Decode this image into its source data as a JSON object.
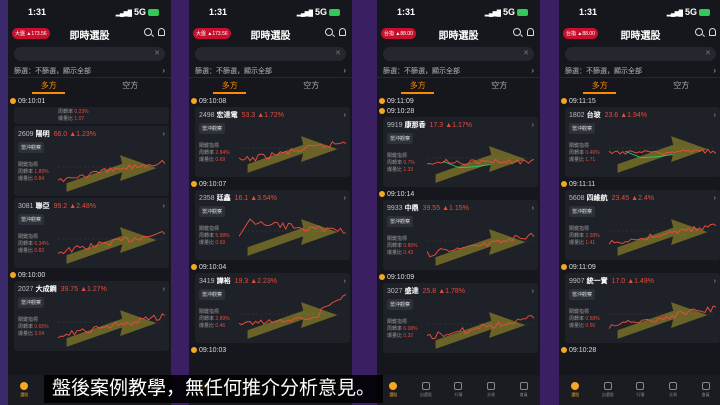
{
  "caption": "盤後案例教學，無任何推介分析意見。",
  "common": {
    "title": "即時選股",
    "filter_text": "篩選：不篩選，顯示全部",
    "tab_long": "多方",
    "tab_short": "空方",
    "observe_label": "當沖觀察",
    "index_label": "關鍵指標",
    "turnover_label": "周轉率",
    "volume_ratio_label": "爆量比",
    "close_mark": "✕",
    "chevron": "›",
    "bottom_nav": [
      "選股",
      "自選股",
      "行情",
      "交易",
      "會員"
    ]
  },
  "colors": {
    "accent": "#ff8a00",
    "up": "#e74c3c",
    "down": "#2ecc71",
    "background": "#15171c"
  },
  "phones": [
    {
      "status_time": "1:31",
      "network": "5G",
      "badge": "大盤 ▲173.56",
      "entries": [
        {
          "time": "09:10:01",
          "card": null,
          "turnover": "0.23%",
          "volume": "1.07",
          "partial": true
        },
        {
          "time": null,
          "card": {
            "code": "2609",
            "name": "陽明",
            "price": "66.0",
            "chg": "▲1.23%"
          },
          "turnover": "1.89%",
          "volume": "0.84"
        },
        {
          "time": null,
          "card": {
            "code": "3081",
            "name": "聯亞",
            "price": "99.2",
            "chg": "▲2.48%"
          },
          "turnover": "6.34%",
          "volume": "0.82"
        },
        {
          "time": "09:10:00",
          "card": {
            "code": "2027",
            "name": "大成鋼",
            "price": "39.75",
            "chg": "▲1.27%"
          },
          "turnover": "0.65%",
          "volume": "3.04"
        }
      ]
    },
    {
      "status_time": "1:31",
      "network": "5G",
      "badge": "大盤 ▲173.56",
      "entries": [
        {
          "time": "09:10:08",
          "card": {
            "code": "2498",
            "name": "宏達電",
            "price": "53.3",
            "chg": "▲1.72%"
          },
          "turnover": "2.84%",
          "volume": "0.69"
        },
        {
          "time": "09:10:07",
          "card": {
            "code": "2358",
            "name": "廷鑫",
            "price": "16.1",
            "chg": "▲3.54%"
          },
          "turnover": "5.98%",
          "volume": "0.69"
        },
        {
          "time": "09:10:04",
          "card": {
            "code": "3419",
            "name": "譁裕",
            "price": "19.3",
            "chg": "▲2.23%"
          },
          "turnover": "2.89%",
          "volume": "0.46"
        },
        {
          "time": "09:10:03",
          "card": null
        }
      ]
    },
    {
      "status_time": "1:31",
      "network": "5G",
      "badge": "台指 ▲88.00",
      "entries": [
        {
          "time": "09:11:09",
          "card": null
        },
        {
          "time": "09:10:28",
          "card": {
            "code": "9919",
            "name": "康那香",
            "price": "17.3",
            "chg": "▲1.17%"
          },
          "turnover": "0.7%",
          "volume": "1.33"
        },
        {
          "time": "09:10:14",
          "card": {
            "code": "9933",
            "name": "中鼎",
            "price": "39.55",
            "chg": "▲1.15%"
          },
          "turnover": "0.86%",
          "volume": "0.43"
        },
        {
          "time": "09:10:09",
          "card": {
            "code": "3027",
            "name": "盛達",
            "price": "25.8",
            "chg": "▲1.78%"
          },
          "turnover": "6.08%",
          "volume": "0.32"
        }
      ]
    },
    {
      "status_time": "1:31",
      "network": "5G",
      "badge": "台指 ▲88.00",
      "entries": [
        {
          "time": "09:11:15",
          "card": {
            "code": "1802",
            "name": "台玻",
            "price": "23.6",
            "chg": "▲1.94%"
          },
          "turnover": "0.46%",
          "volume": "1.71"
        },
        {
          "time": "09:11:11",
          "card": {
            "code": "5608",
            "name": "四維航",
            "price": "23.45",
            "chg": "▲2.4%"
          },
          "turnover": "2.28%",
          "volume": "1.41"
        },
        {
          "time": "09:11:09",
          "card": {
            "code": "9907",
            "name": "統一實",
            "price": "17.0",
            "chg": "▲1.49%"
          },
          "turnover": "0.58%",
          "volume": "0.56"
        },
        {
          "time": "09:10:28",
          "card": null
        }
      ]
    }
  ]
}
